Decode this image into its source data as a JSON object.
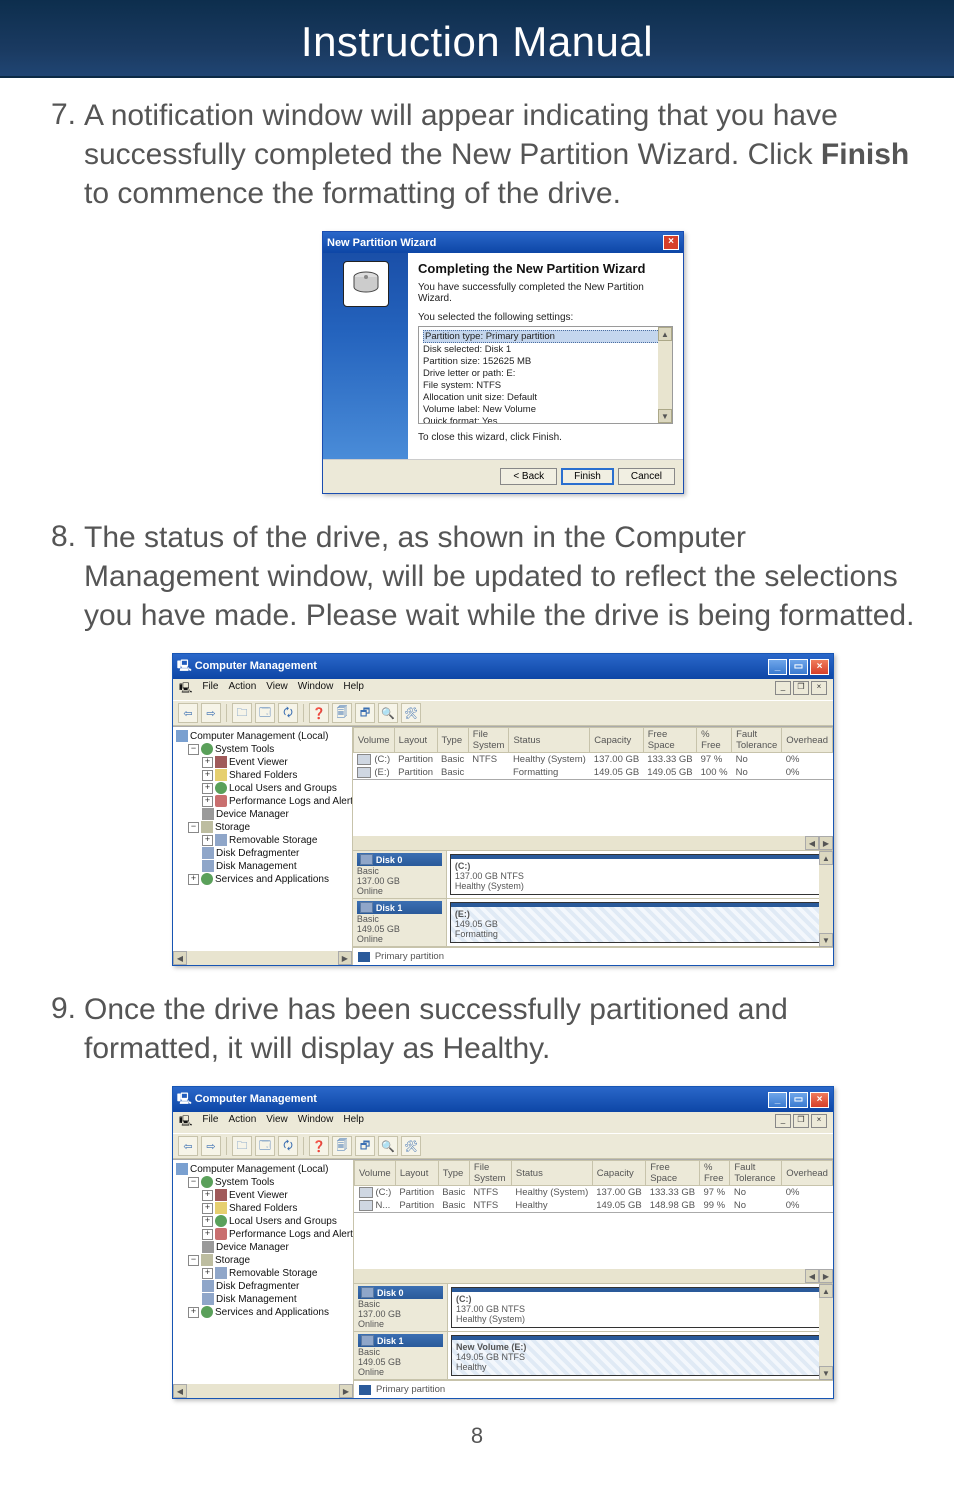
{
  "banner": {
    "title": "Instruction Manual"
  },
  "steps": {
    "s7": {
      "num": "7.",
      "text_a": "A notification window will appear indicating that you have successfully completed the New Partition Wizard. Click ",
      "bold": "Finish",
      "text_b": " to commence the formatting of the drive."
    },
    "s8": {
      "num": "8.",
      "text": "The status of the drive, as shown in the Computer Management window, will be updated to reflect the selections you have made. Please wait while the drive is being formatted."
    },
    "s9": {
      "num": "9.",
      "text": "Once the drive has been successfully partitioned and formatted, it will display as Healthy."
    }
  },
  "wizard": {
    "title": "New Partition Wizard",
    "heading": "Completing the New Partition Wizard",
    "message": "You have successfully completed the New Partition Wizard.",
    "subhead": "You selected the following settings:",
    "settings": {
      "sel": "Partition type: Primary partition",
      "l1": "Disk selected: Disk 1",
      "l2": "Partition size: 152625 MB",
      "l3": "Drive letter or path: E:",
      "l4": "File system: NTFS",
      "l5": "Allocation unit size: Default",
      "l6": "Volume label: New Volume",
      "l7": "Quick format: Yes"
    },
    "close_hint": "To close this wizard, click Finish.",
    "btn_back": "< Back",
    "btn_finish": "Finish",
    "btn_cancel": "Cancel"
  },
  "cm": {
    "title": "Computer Management",
    "menus": {
      "file": "File",
      "action": "Action",
      "view": "View",
      "window": "Window",
      "help": "Help"
    },
    "tree": {
      "root": "Computer Management (Local)",
      "sys": "System Tools",
      "evt": "Event Viewer",
      "shf": "Shared Folders",
      "lug": "Local Users and Groups",
      "perf": "Performance Logs and Alerts",
      "dev": "Device Manager",
      "storage": "Storage",
      "rem": "Removable Storage",
      "defrag": "Disk Defragmenter",
      "dm": "Disk Management",
      "svc": "Services and Applications"
    },
    "grid": {
      "h_vol": "Volume",
      "h_layout": "Layout",
      "h_type": "Type",
      "h_fs": "File System",
      "h_status": "Status",
      "h_cap": "Capacity",
      "h_free": "Free Space",
      "h_pfree": "% Free",
      "h_ft": "Fault Tolerance",
      "h_oh": "Overhead"
    },
    "grid_rows_a": [
      {
        "vol": "(C:)",
        "layout": "Partition",
        "type": "Basic",
        "fs": "NTFS",
        "status": "Healthy (System)",
        "cap": "137.00 GB",
        "free": "133.33 GB",
        "pfree": "97 %",
        "ft": "No",
        "oh": "0%"
      },
      {
        "vol": "(E:)",
        "layout": "Partition",
        "type": "Basic",
        "fs": "",
        "status": "Formatting",
        "cap": "149.05 GB",
        "free": "149.05 GB",
        "pfree": "100 %",
        "ft": "No",
        "oh": "0%"
      }
    ],
    "grid_rows_b": [
      {
        "vol": "(C:)",
        "layout": "Partition",
        "type": "Basic",
        "fs": "NTFS",
        "status": "Healthy (System)",
        "cap": "137.00 GB",
        "free": "133.33 GB",
        "pfree": "97 %",
        "ft": "No",
        "oh": "0%"
      },
      {
        "vol": "N...",
        "layout": "Partition",
        "type": "Basic",
        "fs": "NTFS",
        "status": "Healthy",
        "cap": "149.05 GB",
        "free": "148.98 GB",
        "pfree": "99 %",
        "ft": "No",
        "oh": "0%"
      }
    ],
    "disk0": {
      "name": "Disk 0",
      "type": "Basic",
      "size": "137.00 GB",
      "state": "Online",
      "vol_name": "(C:)",
      "vol_info1": "137.00 GB NTFS",
      "vol_info2": "Healthy (System)"
    },
    "disk1_a": {
      "name": "Disk 1",
      "type": "Basic",
      "size": "149.05 GB",
      "state": "Online",
      "vol_name": "(E:)",
      "vol_info1": "149.05 GB",
      "vol_info2": "Formatting"
    },
    "disk1_b": {
      "name": "Disk 1",
      "type": "Basic",
      "size": "149.05 GB",
      "state": "Online",
      "vol_name": "New Volume  (E:)",
      "vol_info1": "149.05 GB NTFS",
      "vol_info2": "Healthy"
    },
    "legend": "Primary partition"
  },
  "page_number": "8"
}
